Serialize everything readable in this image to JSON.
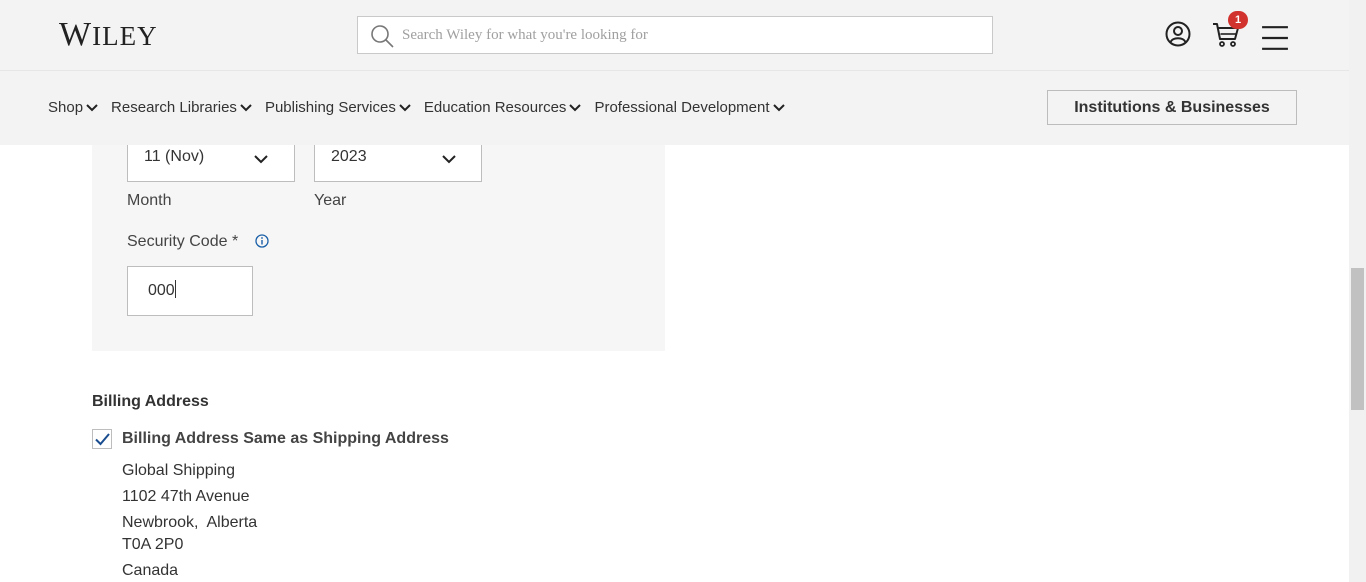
{
  "header": {
    "logo": "Wiley",
    "search_placeholder": "Search Wiley for what you're looking for",
    "cart_count": "1"
  },
  "nav": {
    "items": [
      {
        "label": "Shop"
      },
      {
        "label": "Research Libraries"
      },
      {
        "label": "Publishing Services"
      },
      {
        "label": "Education Resources"
      },
      {
        "label": "Professional Development"
      }
    ],
    "institutions_button": "Institutions & Businesses"
  },
  "payment": {
    "month_value": "11 (Nov)",
    "year_value": "2023",
    "month_label": "Month",
    "year_label": "Year",
    "security_code_label": "Security Code *",
    "security_code_value": "000"
  },
  "billing": {
    "title": "Billing Address",
    "same_as_shipping_label": "Billing Address Same as Shipping Address",
    "same_as_shipping_checked": true,
    "address": {
      "name": "Global Shipping",
      "street": "1102 47th Avenue",
      "city_province": "Newbrook,  Alberta",
      "postal": "T0A 2P0",
      "country": "Canada"
    }
  },
  "colors": {
    "header_bg": "#f3f3f3",
    "badge": "#d2322d",
    "info_icon": "#1a5fa8",
    "checkmark": "#1a4d8f"
  }
}
